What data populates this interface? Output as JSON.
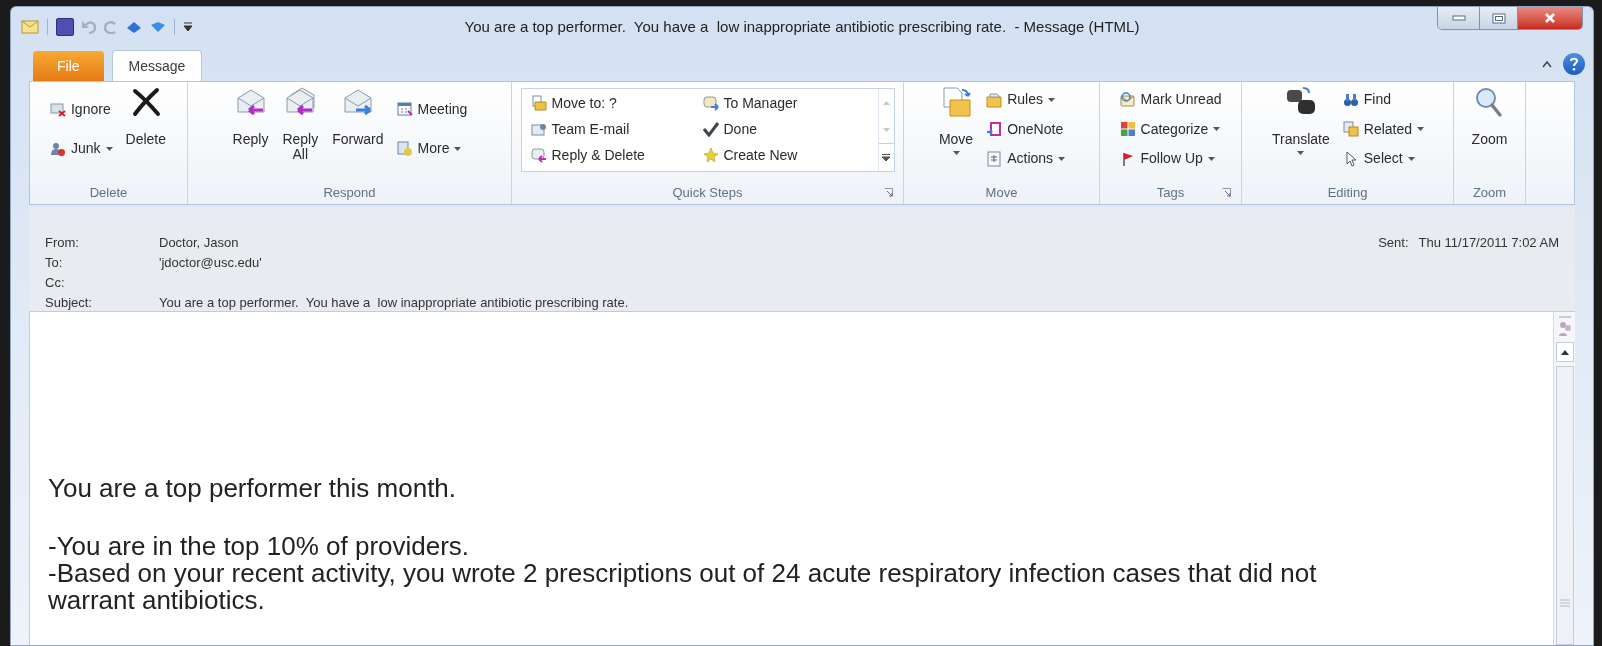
{
  "window": {
    "title": "You are a top performer.  You have a  low inappropriate antibiotic prescribing rate.  - Message (HTML)"
  },
  "tabs": [
    {
      "label": "File",
      "kind": "file",
      "selected": false
    },
    {
      "label": "Message",
      "kind": "tab",
      "selected": true
    }
  ],
  "ribbon": {
    "groups": [
      {
        "label": "Delete",
        "dialog_launcher": false,
        "items": [
          {
            "label": "Ignore",
            "kind": "small",
            "dropdown": false
          },
          {
            "label": "Junk",
            "kind": "small",
            "dropdown": true
          },
          {
            "label": "Delete",
            "kind": "large",
            "dropdown": false
          }
        ]
      },
      {
        "label": "Respond",
        "dialog_launcher": false,
        "items": [
          {
            "label": "Reply",
            "kind": "large",
            "dropdown": false
          },
          {
            "label": "Reply All",
            "kind": "large",
            "dropdown": false
          },
          {
            "label": "Forward",
            "kind": "large",
            "dropdown": false
          },
          {
            "label": "Meeting",
            "kind": "small",
            "dropdown": false
          },
          {
            "label": "More",
            "kind": "small",
            "dropdown": true
          }
        ]
      },
      {
        "label": "Quick Steps",
        "dialog_launcher": true,
        "items": [
          {
            "label": "Move to: ?",
            "kind": "gallery",
            "dropdown": false
          },
          {
            "label": "Team E-mail",
            "kind": "gallery",
            "dropdown": false
          },
          {
            "label": "Reply & Delete",
            "kind": "gallery",
            "dropdown": false
          },
          {
            "label": "To Manager",
            "kind": "gallery",
            "dropdown": false
          },
          {
            "label": "Done",
            "kind": "gallery",
            "dropdown": false
          },
          {
            "label": "Create New",
            "kind": "gallery",
            "dropdown": false
          }
        ]
      },
      {
        "label": "Move",
        "dialog_launcher": false,
        "items": [
          {
            "label": "Move",
            "kind": "large",
            "dropdown": true
          },
          {
            "label": "Rules",
            "kind": "small",
            "dropdown": true
          },
          {
            "label": "OneNote",
            "kind": "small",
            "dropdown": false
          },
          {
            "label": "Actions",
            "kind": "small",
            "dropdown": true
          }
        ]
      },
      {
        "label": "Tags",
        "dialog_launcher": true,
        "items": [
          {
            "label": "Mark Unread",
            "kind": "small",
            "dropdown": false
          },
          {
            "label": "Categorize",
            "kind": "small",
            "dropdown": true
          },
          {
            "label": "Follow Up",
            "kind": "small",
            "dropdown": true
          }
        ]
      },
      {
        "label": "Editing",
        "dialog_launcher": false,
        "items": [
          {
            "label": "Translate",
            "kind": "large",
            "dropdown": true
          },
          {
            "label": "Find",
            "kind": "small",
            "dropdown": false
          },
          {
            "label": "Related",
            "kind": "small",
            "dropdown": true
          },
          {
            "label": "Select",
            "kind": "small",
            "dropdown": true
          }
        ]
      },
      {
        "label": "Zoom",
        "dialog_launcher": false,
        "items": [
          {
            "label": "Zoom",
            "kind": "large",
            "dropdown": false
          }
        ]
      }
    ]
  },
  "message": {
    "fields": [
      {
        "label": "From:",
        "value": "Doctor, Jason"
      },
      {
        "label": "To:",
        "value": "'jdoctor@usc.edu'"
      },
      {
        "label": "Cc:"
      },
      {
        "label": "Subject:",
        "value": "You are a top performer.  You have a  low inappropriate antibiotic prescribing rate."
      }
    ],
    "sent": {
      "label": "Sent:",
      "value": "Thu 11/17/2011 7:02 AM"
    },
    "body": [
      {
        "lines": [
          "You are a top performer this month."
        ]
      },
      {
        "lines": [
          "-You are in the top 10% of providers.",
          "-Based on your recent activity, you wrote 2 prescriptions out of 24 acute respiratory infection cases that did not warrant antibiotics."
        ]
      }
    ]
  }
}
